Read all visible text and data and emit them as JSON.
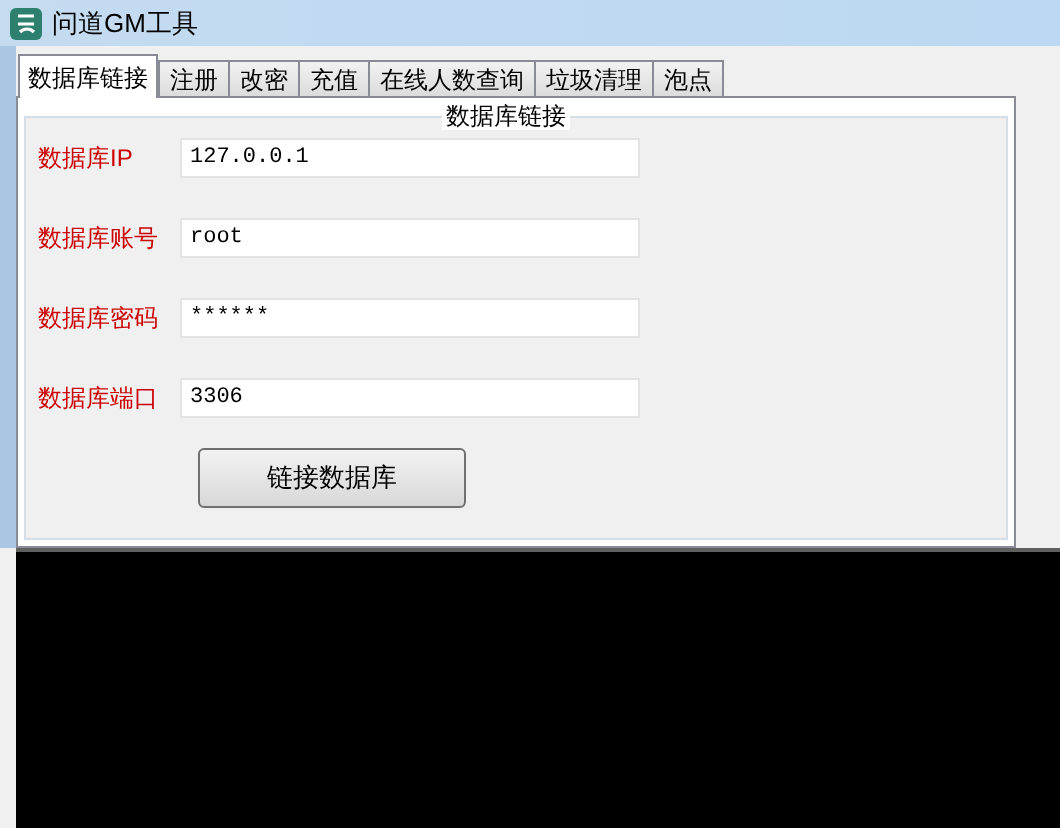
{
  "window": {
    "title": "问道GM工具"
  },
  "tabs": [
    {
      "label": "数据库链接",
      "selected": true
    },
    {
      "label": "注册",
      "selected": false
    },
    {
      "label": "改密",
      "selected": false
    },
    {
      "label": "充值",
      "selected": false
    },
    {
      "label": "在线人数查询",
      "selected": false
    },
    {
      "label": "垃圾清理",
      "selected": false
    },
    {
      "label": "泡点",
      "selected": false
    }
  ],
  "group": {
    "title": "数据库链接"
  },
  "fields": [
    {
      "label": "数据库IP",
      "value": "127.0.0.1"
    },
    {
      "label": "数据库账号",
      "value": "root"
    },
    {
      "label": "数据库密码",
      "value": "******"
    },
    {
      "label": "数据库端口",
      "value": "3306"
    }
  ],
  "button": "链接数据库"
}
